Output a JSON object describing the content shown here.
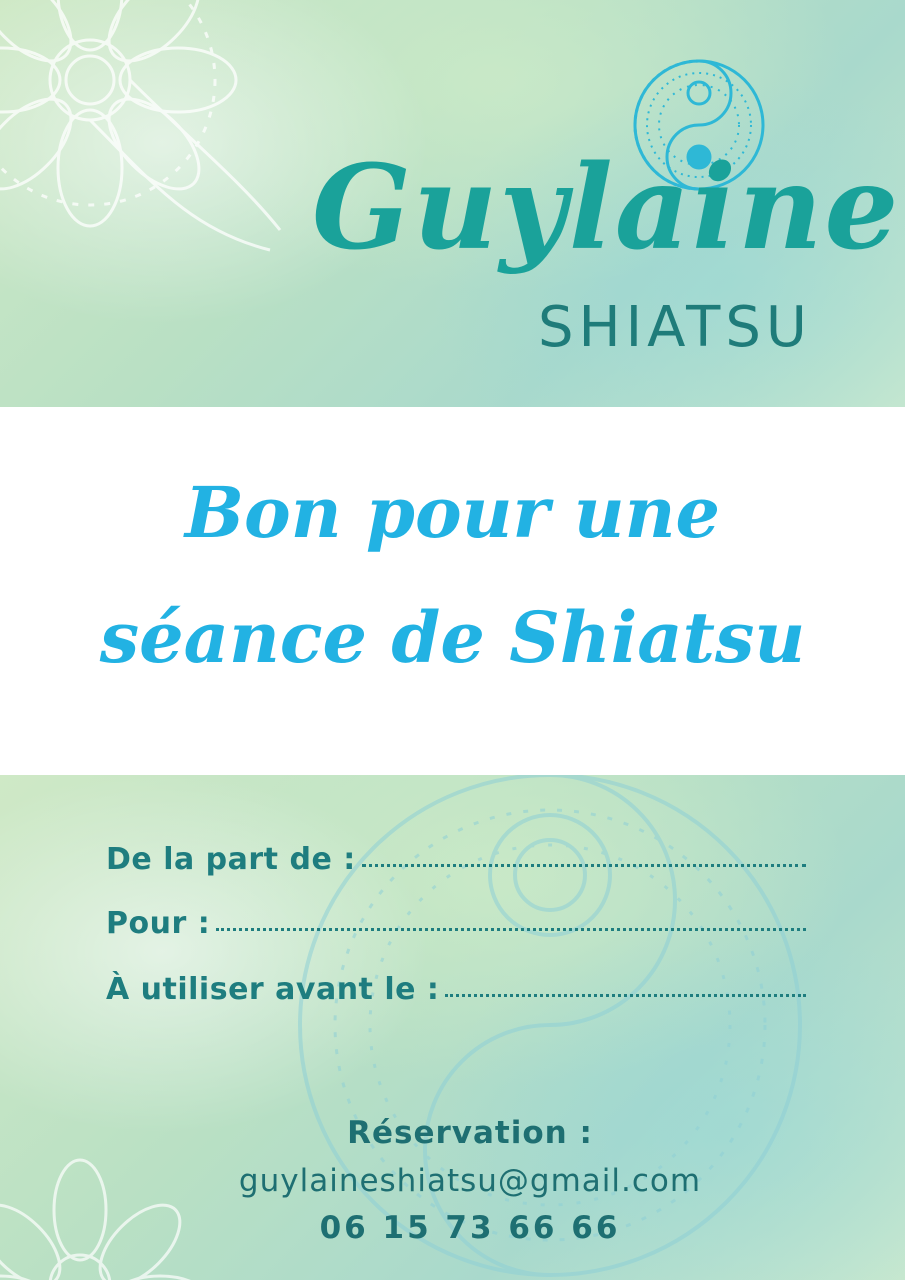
{
  "brand": {
    "name": "Guylaine",
    "subtitle": "SHIATSU",
    "logo_icon": "yin-yang-mandala-icon"
  },
  "voucher": {
    "title_line1": "Bon pour une",
    "title_line2": "séance de Shiatsu"
  },
  "fields": [
    {
      "label": "De la part de :"
    },
    {
      "label": "Pour :"
    },
    {
      "label": "À utiliser avant le :"
    }
  ],
  "reservation": {
    "label": "Réservation :",
    "email": "guylaineshiatsu@gmail.com",
    "phone": "06 15 73 66 66"
  },
  "colors": {
    "brand_teal": "#1aa29a",
    "title_blue": "#22b2e3",
    "text_teal": "#1e7d7f",
    "band_green": "#b9e0c4"
  }
}
